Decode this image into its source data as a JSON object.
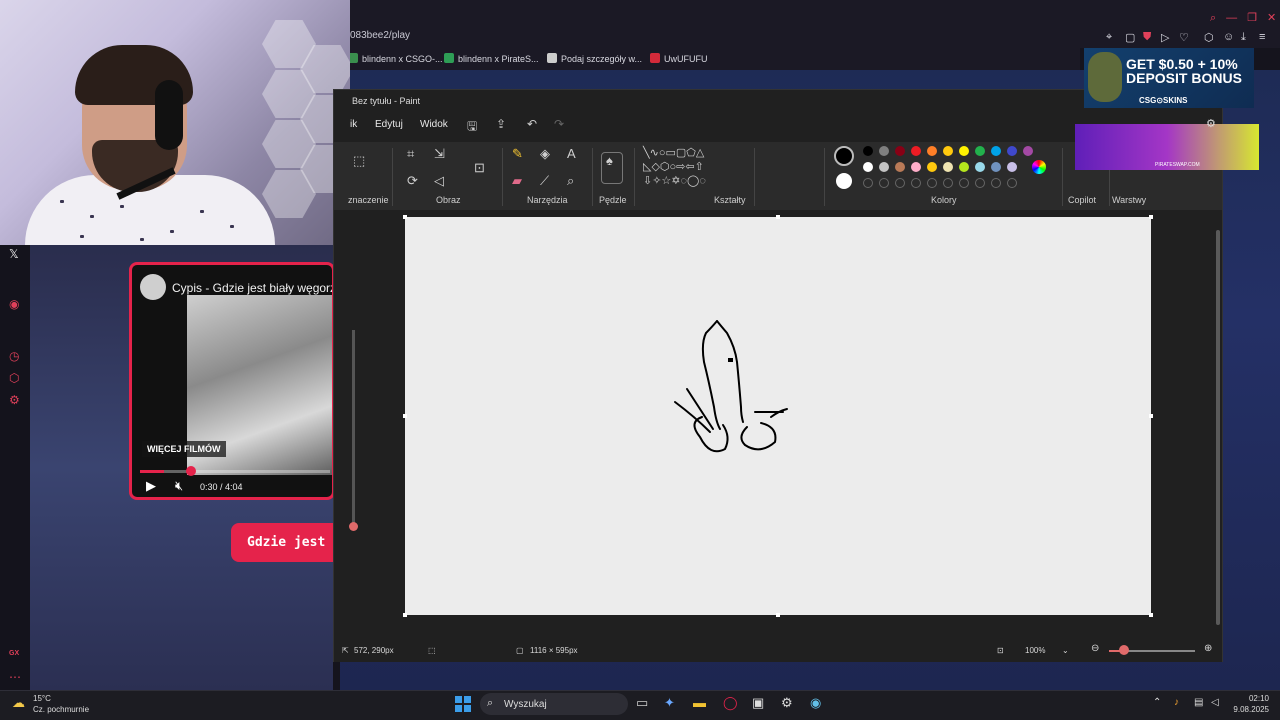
{
  "browser": {
    "url": "083bee2/play",
    "bookmarks": [
      {
        "label": "blindenn x CSGO-...",
        "color": "#3a8f4e"
      },
      {
        "label": "blindenn x PirateS...",
        "color": "#2e9e56"
      },
      {
        "label": "Podaj szczegóły w...",
        "color": "#cccccc"
      },
      {
        "label": "UwUFUFU",
        "color": "#d42a3a"
      }
    ]
  },
  "video": {
    "title": "Cypis - Gdzie jest biały węgorz",
    "more_videos": "WIĘCEJ FILMÓW",
    "time": "0:30 / 4:04",
    "progress": 0.124
  },
  "page": {
    "red_button": "Gdzie jest"
  },
  "paint": {
    "title": "Bez tytułu - Paint",
    "menu": {
      "file_partial": "ik",
      "edit": "Edytuj",
      "view": "Widok"
    },
    "groups": {
      "selection": "znaczenie",
      "image": "Obraz",
      "tools": "Narzędzia",
      "brushes": "Pędzle",
      "shapes": "Kształty",
      "colors": "Kolory",
      "copilot": "Copilot",
      "layers": "Warstwy"
    },
    "palette_row1": [
      "#000000",
      "#7f7f7f",
      "#880015",
      "#ed1c24",
      "#ff7f27",
      "#ffc90e",
      "#fff200",
      "#22b14c",
      "#00a2e8",
      "#3f48cc",
      "#a349a4"
    ],
    "palette_row2": [
      "#ffffff",
      "#c3c3c3",
      "#b97a57",
      "#ffaec9",
      "#ffc90e",
      "#efe4b0",
      "#b5e61d",
      "#99d9ea",
      "#7092be",
      "#c8bfe7"
    ],
    "status": {
      "cursor": "572, 290px",
      "canvas_size": "1116 × 595px",
      "zoom": "100%"
    }
  },
  "ads": {
    "ad1_text": "GET $0.50 + 10% DEPOSIT BONUS",
    "ad1_brand": "CSG⊙SKINS",
    "ad2_brand": "PIRATESWAP.COM"
  },
  "taskbar": {
    "temp": "15°C",
    "weather": "Cz. pochmurnie",
    "search_placeholder": "Wyszukaj",
    "time": "02:10",
    "date": "9.08.2025"
  }
}
